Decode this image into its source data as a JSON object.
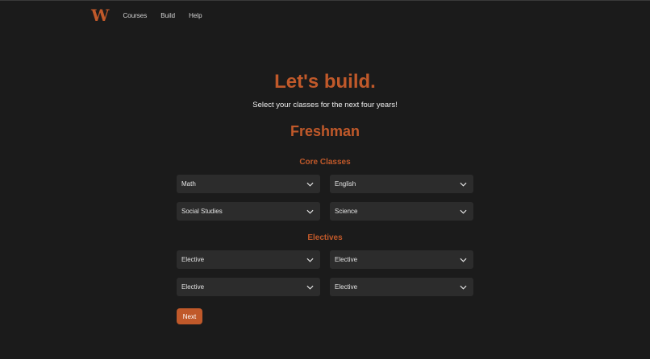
{
  "nav": {
    "logo": "W",
    "links": [
      "Courses",
      "Build",
      "Help"
    ]
  },
  "hero": {
    "title": "Let's build.",
    "subtitle": "Select your classes for the next four years!"
  },
  "year": "Freshman",
  "core": {
    "heading": "Core Classes",
    "selects": [
      "Math",
      "English",
      "Social Studies",
      "Science"
    ]
  },
  "electives": {
    "heading": "Electives",
    "selects": [
      "Elective",
      "Elective",
      "Elective",
      "Elective"
    ]
  },
  "next_label": "Next",
  "colors": {
    "accent": "#c0592a",
    "background": "#1b1b1b",
    "select_bg": "#2c2c2c"
  },
  "icons": {
    "dropdown": "chevron-down-icon"
  }
}
